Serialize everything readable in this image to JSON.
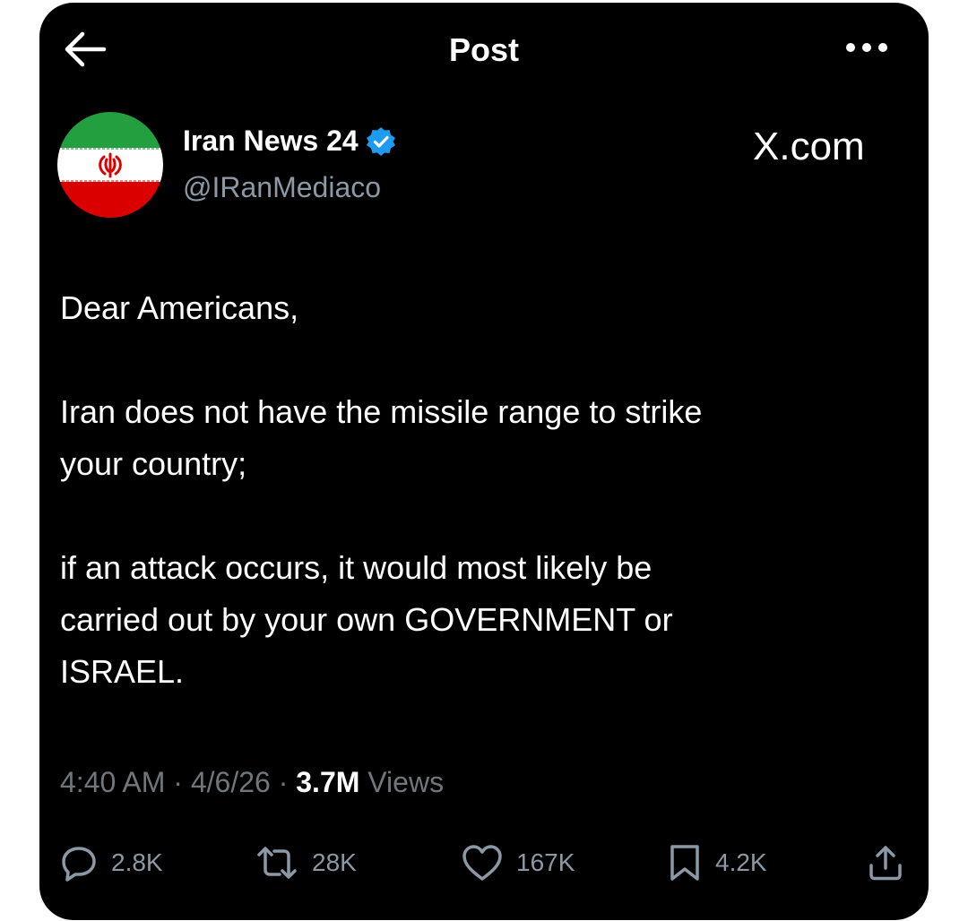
{
  "header": {
    "title": "Post",
    "back_icon": "arrow-left-icon",
    "more_icon": "more-horizontal-icon"
  },
  "author": {
    "name": "Iran News 24",
    "handle": "@IRanMediaco",
    "verified": true,
    "avatar": "iran-flag-avatar"
  },
  "source_label": "X.com",
  "tweet": {
    "paragraphs": [
      "Dear Americans,",
      "Iran does not have the missile range to strike\nyour country;",
      "if an attack occurs, it would most likely be\ncarried out by your own GOVERNMENT or\nISRAEL."
    ]
  },
  "meta": {
    "time": "4:40 AM",
    "separator": "·",
    "date": "4/6/26",
    "views_count": "3.7M",
    "views_label": "Views"
  },
  "actions": {
    "replies": "2.8K",
    "reposts": "28K",
    "likes": "167K",
    "bookmarks": "4.2K"
  },
  "colors": {
    "background": "#000000",
    "text": "#ffffff",
    "muted": "#71767b",
    "icon": "#8b98a5",
    "verified": "#1d9bf0"
  }
}
